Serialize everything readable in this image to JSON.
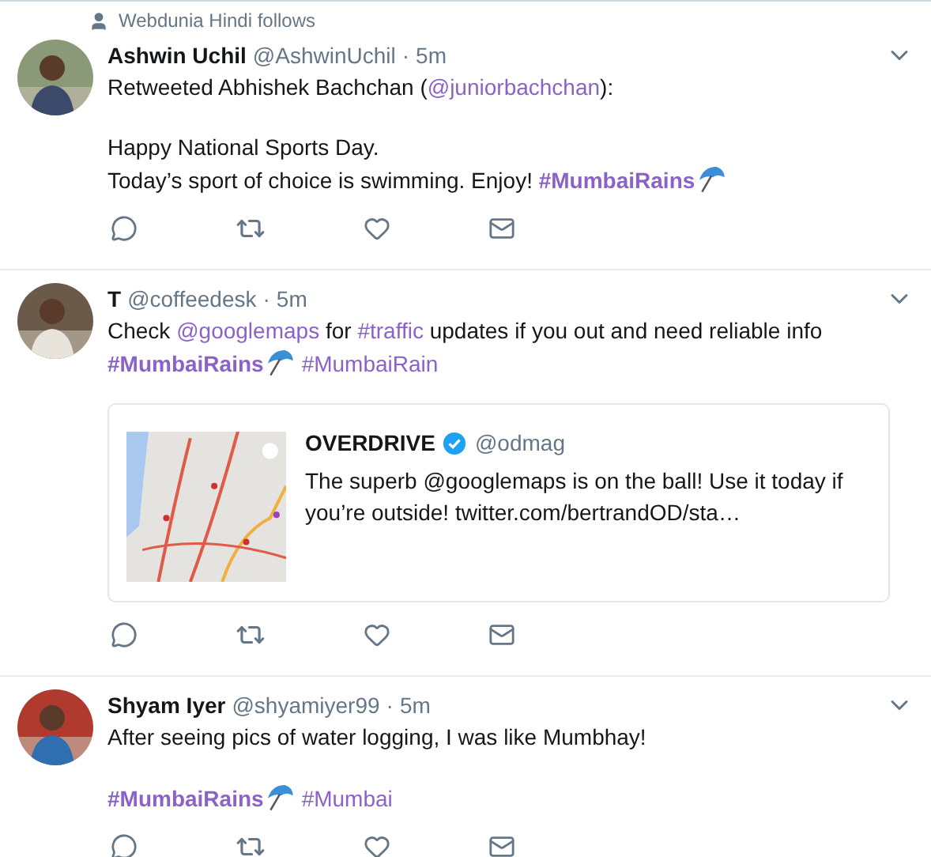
{
  "tweets": [
    {
      "social_context": "Webdunia Hindi follows",
      "name": "Ashwin Uchil",
      "handle": "@AshwinUchil",
      "separator": "·",
      "time": "5m",
      "avatar": {
        "kind": "picture"
      },
      "paragraphs": [
        [
          [
            {
              "kind": "text",
              "text": "Retweeted Abhishek Bachchan ("
            },
            {
              "kind": "mention",
              "text": "@juniorbachchan"
            },
            {
              "kind": "text",
              "text": "):"
            }
          ]
        ],
        [
          [
            {
              "kind": "text",
              "text": "Happy National Sports Day."
            }
          ],
          [
            {
              "kind": "text",
              "text": "Today’s sport of choice is swimming. Enjoy! "
            },
            {
              "kind": "trend",
              "text": "#MumbaiRains"
            }
          ]
        ]
      ]
    },
    {
      "name": "T",
      "handle": "@coffeedesk",
      "separator": "·",
      "time": "5m",
      "avatar": {
        "kind": "picture"
      },
      "paragraphs": [
        [
          [
            {
              "kind": "text",
              "text": "Check "
            },
            {
              "kind": "mention",
              "text": "@googlemaps"
            },
            {
              "kind": "text",
              "text": " for "
            },
            {
              "kind": "hashtag",
              "text": "#traffic"
            },
            {
              "kind": "text",
              "text": " updates if you out and need reliable info"
            }
          ],
          [
            {
              "kind": "trend",
              "text": "#MumbaiRains"
            },
            {
              "kind": "hashtag",
              "text": "#MumbaiRain"
            }
          ]
        ]
      ],
      "card": {
        "name": "OVERDRIVE",
        "verified": true,
        "handle": "@odmag",
        "text": "The superb @googlemaps is on the ball! Use it today if you’re outside! twitter.com/bertrandOD/sta…",
        "image": {
          "kind": "picture"
        }
      }
    },
    {
      "name": "Shyam Iyer",
      "handle": "@shyamiyer99",
      "separator": "·",
      "time": "5m",
      "avatar": {
        "kind": "picture"
      },
      "paragraphs": [
        [
          [
            {
              "kind": "text",
              "text": "After seeing pics of water logging, I was like Mumbhay!"
            }
          ]
        ],
        [
          [
            {
              "kind": "trend",
              "text": "#MumbaiRains"
            },
            {
              "kind": "hashtag",
              "text": "#Mumbai"
            }
          ]
        ]
      ]
    }
  ]
}
